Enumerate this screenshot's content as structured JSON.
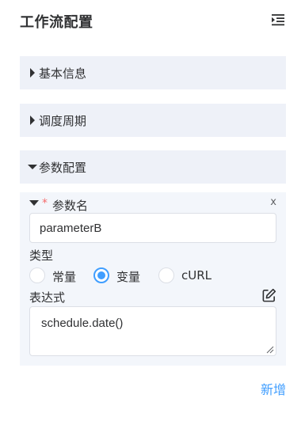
{
  "header": {
    "title": "工作流配置"
  },
  "sections": [
    {
      "label": "基本信息",
      "expanded": false
    },
    {
      "label": "调度周期",
      "expanded": false
    },
    {
      "label": "参数配置",
      "expanded": true
    }
  ],
  "param": {
    "required_mark": "*",
    "name_label": "参数名",
    "remove_label": "x",
    "name_value": "parameterB",
    "type_label": "类型",
    "type_options": [
      {
        "label": "常量",
        "checked": false
      },
      {
        "label": "变量",
        "checked": true
      },
      {
        "label": "cURL",
        "checked": false
      }
    ],
    "expression_label": "表达式",
    "expression_value": "schedule.date()"
  },
  "add_label": "新增",
  "colors": {
    "accent": "#409eff",
    "section_bg": "#eef1f8",
    "card_bg": "#f3f6fb",
    "required": "#f56c6c"
  },
  "icons": [
    "collapse-menu-icon",
    "caret-right-icon",
    "caret-down-icon",
    "edit-icon",
    "resize-grip-icon"
  ]
}
